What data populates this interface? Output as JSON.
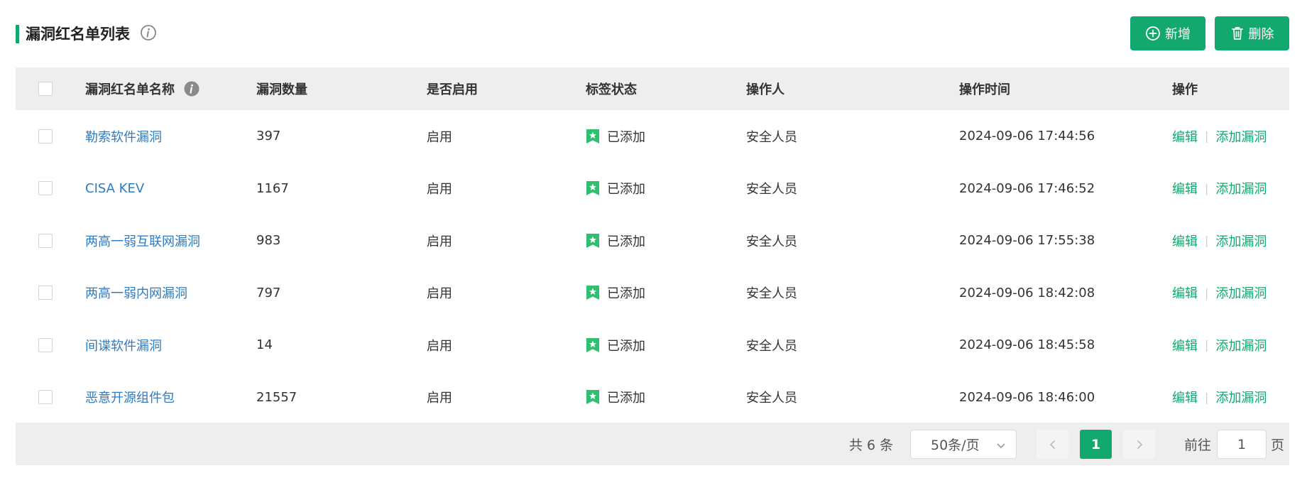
{
  "header": {
    "title": "漏洞红名单列表",
    "add_label": "新增",
    "delete_label": "删除"
  },
  "table": {
    "columns": [
      "漏洞红名单名称",
      "漏洞数量",
      "是否启用",
      "标签状态",
      "操作人",
      "操作时间",
      "操作"
    ],
    "rows": [
      {
        "name": "勒索软件漏洞",
        "count": "397",
        "enabled": "启用",
        "tag": "已添加",
        "operator": "安全人员",
        "time": "2024-09-06 17:44:56"
      },
      {
        "name": "CISA KEV",
        "count": "1167",
        "enabled": "启用",
        "tag": "已添加",
        "operator": "安全人员",
        "time": "2024-09-06 17:46:52"
      },
      {
        "name": "两高一弱互联网漏洞",
        "count": "983",
        "enabled": "启用",
        "tag": "已添加",
        "operator": "安全人员",
        "time": "2024-09-06 17:55:38"
      },
      {
        "name": "两高一弱内网漏洞",
        "count": "797",
        "enabled": "启用",
        "tag": "已添加",
        "operator": "安全人员",
        "time": "2024-09-06 18:42:08"
      },
      {
        "name": "间谍软件漏洞",
        "count": "14",
        "enabled": "启用",
        "tag": "已添加",
        "operator": "安全人员",
        "time": "2024-09-06 18:45:58"
      },
      {
        "name": "恶意开源组件包",
        "count": "21557",
        "enabled": "启用",
        "tag": "已添加",
        "operator": "安全人员",
        "time": "2024-09-06 18:46:00"
      }
    ],
    "actions": {
      "edit": "编辑",
      "add_vuln": "添加漏洞"
    }
  },
  "pagination": {
    "total": "共 6 条",
    "page_size": "50条/页",
    "current_page": "1",
    "goto_label": "前往",
    "goto_value": "1",
    "goto_suffix": "页"
  },
  "colors": {
    "primary": "#13a86e",
    "link": "#2f7bbf",
    "header_bg": "#eeeeee"
  },
  "icons": {
    "title_info": "info-icon",
    "add": "plus-circle-icon",
    "delete": "trash-icon",
    "tag": "star-bookmark-icon",
    "prev": "chevron-left-icon",
    "next": "chevron-right-icon",
    "select": "chevron-down-icon"
  }
}
